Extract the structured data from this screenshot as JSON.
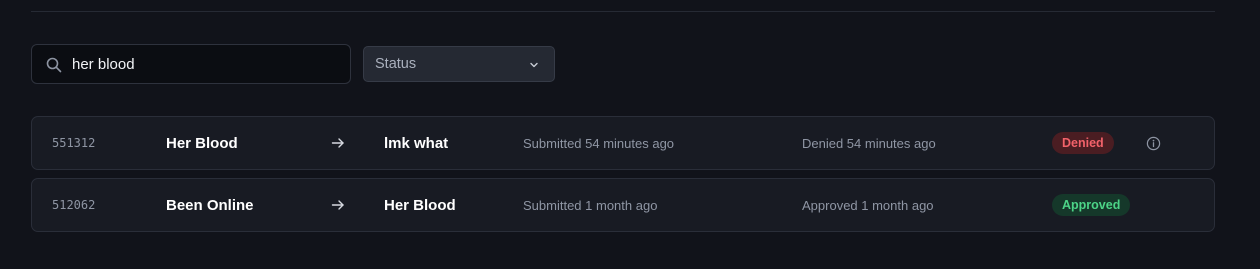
{
  "search": {
    "value": "her blood",
    "icon": "search-icon"
  },
  "status_filter": {
    "selected": "Status",
    "icon": "chevron-down-icon"
  },
  "colors": {
    "denied": "#f2626a",
    "approved": "#4cd487",
    "background": "#11131a"
  },
  "rows": [
    {
      "id": "551312",
      "from": "Her Blood",
      "to": "lmk what",
      "submitted": "Submitted 54 minutes ago",
      "decided": "Denied 54 minutes ago",
      "status": "Denied",
      "has_info": true
    },
    {
      "id": "512062",
      "from": "Been Online",
      "to": "Her Blood",
      "submitted": "Submitted 1 month ago",
      "decided": "Approved 1 month ago",
      "status": "Approved",
      "has_info": false
    }
  ]
}
